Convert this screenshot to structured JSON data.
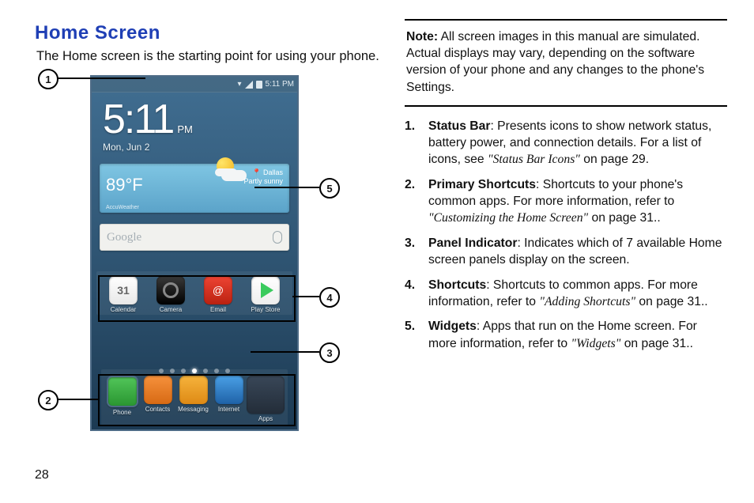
{
  "page_number": "28",
  "heading": "Home Screen",
  "intro": "The Home screen is the starting point for using your phone.",
  "note_label": "Note:",
  "note_body": "All screen images in this manual are simulated. Actual displays may vary, depending on the software version of your phone and any changes to the phone's Settings.",
  "items": [
    {
      "num": "1.",
      "title": "Status Bar",
      "desc": ": Presents icons to show network status, battery power, and connection details. For a list of icons, see ",
      "ref": "\"Status Bar Icons\"",
      "tail": " on page 29."
    },
    {
      "num": "2.",
      "title": "Primary Shortcuts",
      "desc": ": Shortcuts to your phone's common apps. For more information, refer to ",
      "ref": "\"Customizing the Home Screen\"",
      "tail": " on page 31.."
    },
    {
      "num": "3.",
      "title": "Panel Indicator",
      "desc": ": Indicates which of 7 available Home screen panels display on the screen.",
      "ref": "",
      "tail": ""
    },
    {
      "num": "4.",
      "title": "Shortcuts",
      "desc": ": Shortcuts to common apps. For more information, refer to ",
      "ref": "\"Adding Shortcuts\"",
      "tail": " on page 31.."
    },
    {
      "num": "5.",
      "title": "Widgets",
      "desc": ": Apps that run on the Home screen. For more information, refer to ",
      "ref": "\"Widgets\"",
      "tail": " on page 31.."
    }
  ],
  "callouts": {
    "c1": "1",
    "c2": "2",
    "c3": "3",
    "c4": "4",
    "c5": "5"
  },
  "phone": {
    "status_time": "5:11 PM",
    "clock_time": "5:11",
    "clock_ampm": "PM",
    "clock_date": "Mon, Jun 2",
    "weather_temp": "89°F",
    "weather_loc": "Dallas",
    "weather_cond": "Partly sunny",
    "weather_brand": "AccuWeather",
    "search_brand": "Google",
    "row1": [
      {
        "label": "Calendar",
        "cls": "cal",
        "txt": "31"
      },
      {
        "label": "Camera",
        "cls": "cam",
        "txt": ""
      },
      {
        "label": "Email",
        "cls": "mail",
        "txt": ""
      },
      {
        "label": "Play Store",
        "cls": "play",
        "txt": ""
      }
    ],
    "row2": [
      {
        "label": "Phone",
        "cls": "phone",
        "txt": ""
      },
      {
        "label": "Contacts",
        "cls": "contacts",
        "txt": ""
      },
      {
        "label": "Messaging",
        "cls": "msg",
        "txt": ""
      },
      {
        "label": "Internet",
        "cls": "net",
        "txt": ""
      },
      {
        "label": "Apps",
        "cls": "apps",
        "txt": ""
      }
    ]
  }
}
